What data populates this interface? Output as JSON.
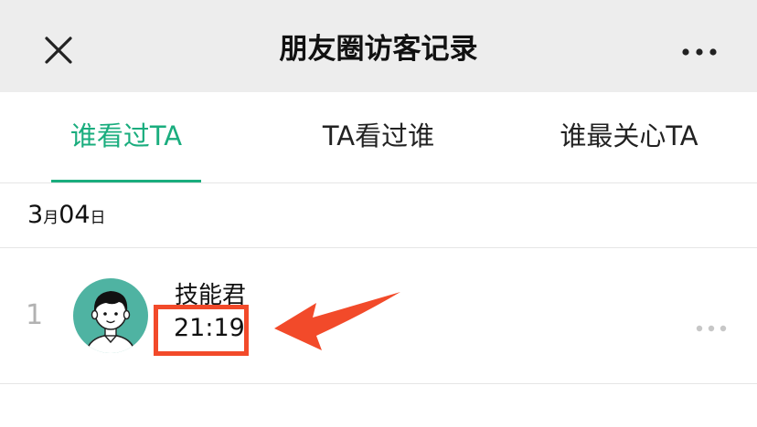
{
  "header": {
    "title": "朋友圈访客记录",
    "close_icon": "close-icon",
    "more_icon": "more-horizontal-icon"
  },
  "tabs": [
    {
      "label": "谁看过TA",
      "active": true
    },
    {
      "label": "TA看过谁",
      "active": false
    },
    {
      "label": "谁最关心TA",
      "active": false
    }
  ],
  "date_group": {
    "month": "3",
    "month_unit": "月",
    "day": "04",
    "day_unit": "日"
  },
  "visitors": [
    {
      "index": "1",
      "name": "技能君",
      "time": "21:19",
      "avatar_icon": "cartoon-avatar-icon",
      "more_icon": "more-dots-icon"
    }
  ],
  "annotation": {
    "highlight_color": "#f24a2a",
    "arrow_icon": "red-arrow-icon"
  },
  "colors": {
    "accent": "#1aad7e",
    "header_bg": "#ededed",
    "avatar_bg": "#4fb3a2"
  }
}
